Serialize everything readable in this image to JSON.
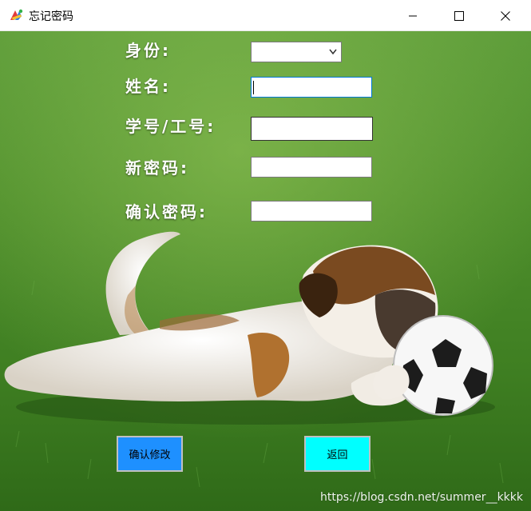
{
  "window": {
    "title": "忘记密码",
    "accent": "#ffffff"
  },
  "form": {
    "identity_label": "身份:",
    "identity_value": "",
    "name_label": "姓名:",
    "name_value": "",
    "id_label": "学号/工号:",
    "id_value": "",
    "new_password_label": "新密码:",
    "new_password_value": "",
    "confirm_password_label": "确认密码:",
    "confirm_password_value": ""
  },
  "buttons": {
    "confirm_label": "确认修改",
    "confirm_color": "#1e90ff",
    "back_label": "返回",
    "back_color": "#00ffff"
  },
  "watermark": "https://blog.csdn.net/summer__kkkk",
  "icons": {
    "app": "app-icon",
    "minimize": "minimize-icon",
    "maximize": "maximize-icon",
    "close": "close-icon",
    "dropdown": "chevron-down-icon"
  }
}
